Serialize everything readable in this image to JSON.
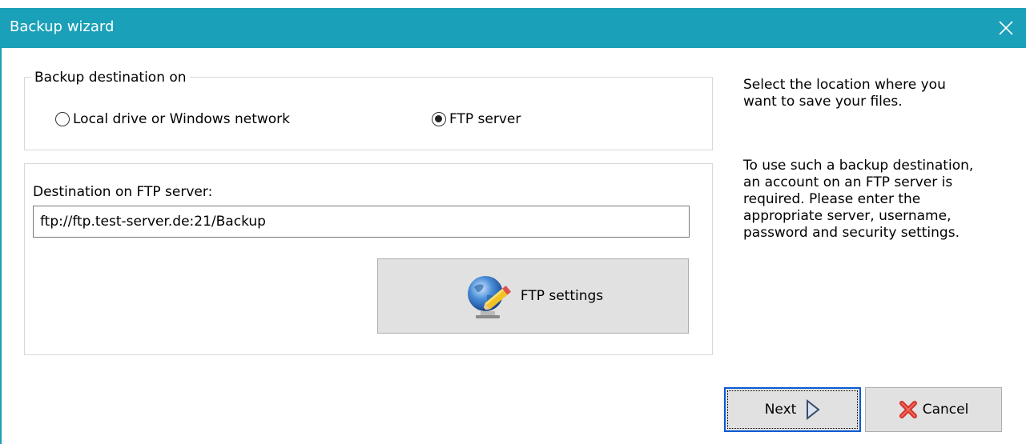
{
  "window": {
    "title": "Backup wizard",
    "accent_color": "#1aa0b8",
    "close_icon": "close-icon"
  },
  "destination_group": {
    "legend": "Backup destination on",
    "options": [
      {
        "label": "Local drive or Windows network",
        "selected": false
      },
      {
        "label": "FTP server",
        "selected": true
      }
    ]
  },
  "ftp_panel": {
    "label": "Destination on FTP server:",
    "value": "ftp://ftp.test-server.de:21/Backup",
    "settings_button": {
      "label": "FTP settings",
      "icon": "globe-pencil-icon"
    }
  },
  "help": {
    "paragraph1": [
      "Select the location where you",
      "want to save your files."
    ],
    "paragraph2": [
      "To use such a backup destination,",
      "an account on an FTP server is",
      "required. Please enter the",
      "appropriate server, username,",
      "password and security settings."
    ]
  },
  "footer": {
    "next_label": "Next",
    "next_icon": "arrow-right-icon",
    "cancel_label": "Cancel",
    "cancel_icon": "red-x-icon"
  }
}
